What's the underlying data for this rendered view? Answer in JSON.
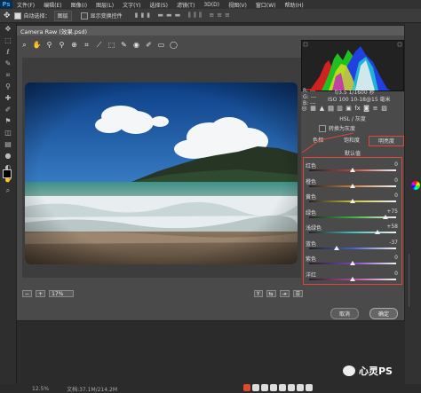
{
  "menubar": {
    "logo": "Ps",
    "items": [
      "文件(F)",
      "编辑(E)",
      "图像(I)",
      "图层(L)",
      "文字(Y)",
      "选择(S)",
      "滤镜(T)",
      "3D(D)",
      "视图(V)",
      "窗口(W)",
      "帮助(H)"
    ]
  },
  "optbar": {
    "auto_select": "自动选择：",
    "group": "图层",
    "show_transform": "显示变换控件"
  },
  "dialog": {
    "title": "Camera Raw (效果.psd)",
    "zoom": "17%",
    "cancel": "取消",
    "ok": "确定"
  },
  "cam_info": {
    "line1": "f/3.5   1/1600 秒",
    "line2": "ISO 100   10-18@15 毫米",
    "rgb": [
      "R: ---",
      "G: ---",
      "B: ---"
    ]
  },
  "panel": {
    "title": "HSL / 灰度",
    "gray_label": "转换为灰度",
    "tabs": [
      "色相",
      "饱和度",
      "明亮度"
    ],
    "default_label": "默认值",
    "sliders": [
      {
        "label": "红色",
        "value": "0",
        "pos": 0.5,
        "track": "#c94040"
      },
      {
        "label": "橙色",
        "value": "0",
        "pos": 0.5,
        "track": "#d08040"
      },
      {
        "label": "黄色",
        "value": "0",
        "pos": 0.5,
        "track": "#d0c040"
      },
      {
        "label": "绿色",
        "value": "+75",
        "pos": 0.875,
        "track": "#40b040"
      },
      {
        "label": "浅绿色",
        "value": "+58",
        "pos": 0.79,
        "track": "#40c0c0"
      },
      {
        "label": "蓝色",
        "value": "-37",
        "pos": 0.315,
        "track": "#4060d0"
      },
      {
        "label": "紫色",
        "value": "0",
        "pos": 0.5,
        "track": "#8040c0"
      },
      {
        "label": "洋红",
        "value": "0",
        "pos": 0.5,
        "track": "#c040a0"
      }
    ]
  },
  "status": {
    "zoom": "12.5%",
    "doc": "文档:37.1M/214.2M"
  },
  "watermark": {
    "name": "心灵PS"
  },
  "colors": {
    "accent_red": "#e0463a",
    "panel_bg": "#4a4a4a"
  }
}
